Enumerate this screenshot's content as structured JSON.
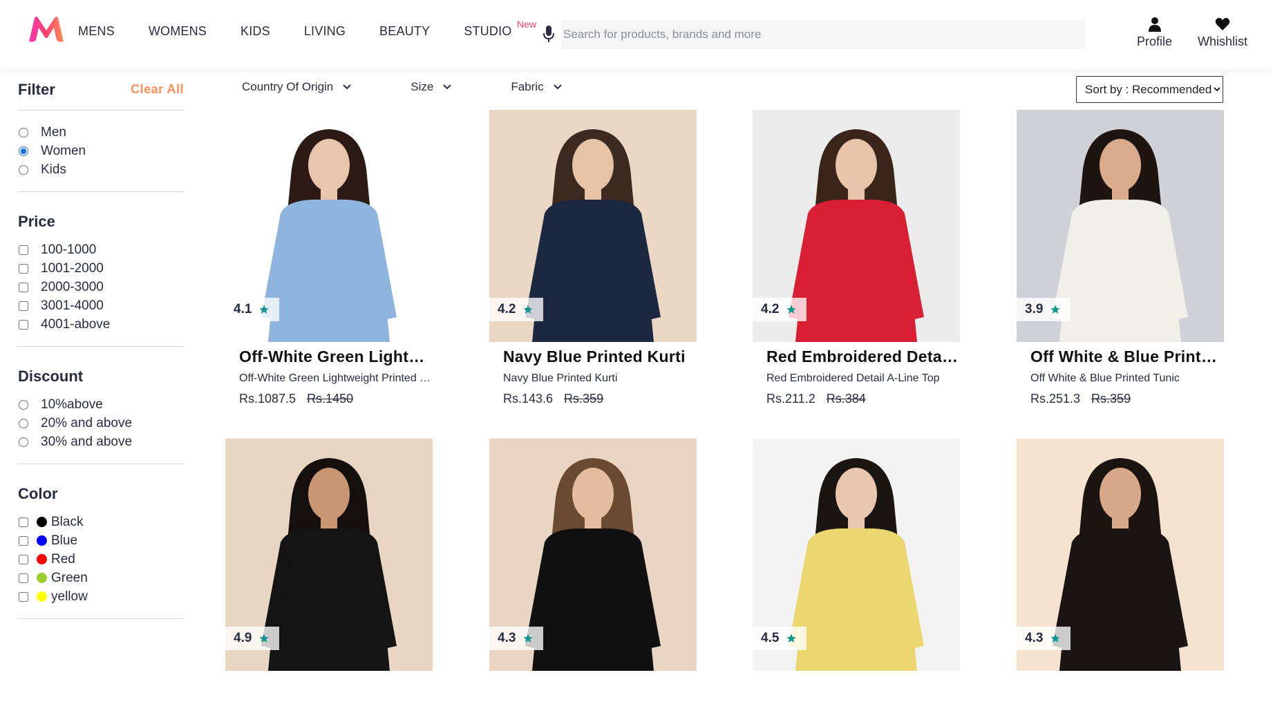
{
  "header": {
    "nav": [
      {
        "label": "MENS"
      },
      {
        "label": "WOMENS"
      },
      {
        "label": "KIDS"
      },
      {
        "label": "LIVING"
      },
      {
        "label": "BEAUTY"
      },
      {
        "label": "STUDIO",
        "badge": "New"
      }
    ],
    "search_placeholder": "Search for products, brands and more",
    "profile_label": "Profile",
    "wishlist_label": "Whishlist",
    "brand_colors": [
      "#ff3f6c",
      "#f13ab1",
      "#ff905a"
    ]
  },
  "sidebar": {
    "title": "Filter",
    "clear_all": "Clear All",
    "gender": {
      "options": [
        "Men",
        "Women",
        "Kids"
      ],
      "selected": "Women"
    },
    "price": {
      "title": "Price",
      "options": [
        "100-1000",
        "1001-2000",
        "2000-3000",
        "3001-4000",
        "4001-above"
      ]
    },
    "discount": {
      "title": "Discount",
      "options": [
        "10%above",
        "20% and above",
        "30% and above"
      ]
    },
    "color": {
      "title": "Color",
      "options": [
        {
          "label": "Black",
          "swatch": "#000000"
        },
        {
          "label": "Blue",
          "swatch": "#0000ff"
        },
        {
          "label": "Red",
          "swatch": "#ff0000"
        },
        {
          "label": "Green",
          "swatch": "#9acd32"
        },
        {
          "label": "yellow",
          "swatch": "#ffff00"
        }
      ]
    }
  },
  "toolbar": {
    "filters": [
      "Country Of Origin",
      "Size",
      "Fabric"
    ],
    "sort_label": "Sort by : Recommended"
  },
  "products": [
    {
      "rating": "4.1",
      "name": "Off-White Green Lightweight Printed Top",
      "desc": "Off-White Green Lightweight Printed Top",
      "price": "Rs.1087.5",
      "mrp": "Rs.1450",
      "bg": "#ffffff",
      "garment": "#8fb4de",
      "skin": "#e8c6ad",
      "hair": "#2b1b14"
    },
    {
      "rating": "4.2",
      "name": "Navy Blue Printed Kurti",
      "desc": "Navy Blue Printed Kurti",
      "price": "Rs.143.6",
      "mrp": "Rs.359",
      "bg": "#ead7c4",
      "garment": "#1c2740",
      "skin": "#e6c2a6",
      "hair": "#3a2a20"
    },
    {
      "rating": "4.2",
      "name": "Red Embroidered Detail A-Line Top",
      "desc": "Red Embroidered Detail A-Line Top",
      "price": "Rs.211.2",
      "mrp": "Rs.384",
      "bg": "#ececec",
      "garment": "#d81f33",
      "skin": "#e8c4aa",
      "hair": "#3b2419"
    },
    {
      "rating": "3.9",
      "name": "Off White & Blue Printed Tunic",
      "desc": "Off White & Blue Printed Tunic",
      "price": "Rs.251.3",
      "mrp": "Rs.359",
      "bg": "#cfd1d6",
      "garment": "#f0efe9",
      "skin": "#d9ab8b",
      "hair": "#1e1410"
    },
    {
      "rating": "4.9",
      "name": "",
      "desc": "",
      "price": "",
      "mrp": "",
      "bg": "#e8d6c3",
      "garment": "#141414",
      "skin": "#c99674",
      "hair": "#15100d"
    },
    {
      "rating": "4.3",
      "name": "",
      "desc": "",
      "price": "",
      "mrp": "",
      "bg": "#ead5c2",
      "garment": "#101010",
      "skin": "#e4bca0",
      "hair": "#6a4a30"
    },
    {
      "rating": "4.5",
      "name": "",
      "desc": "",
      "price": "",
      "mrp": "",
      "bg": "#f3f3f3",
      "garment": "#ebd66f",
      "skin": "#e8c7ae",
      "hair": "#1c1613"
    },
    {
      "rating": "4.3",
      "name": "",
      "desc": "",
      "price": "",
      "mrp": "",
      "bg": "#f4e3cf",
      "garment": "#1a1414",
      "skin": "#d8a88a",
      "hair": "#1c1411"
    }
  ]
}
